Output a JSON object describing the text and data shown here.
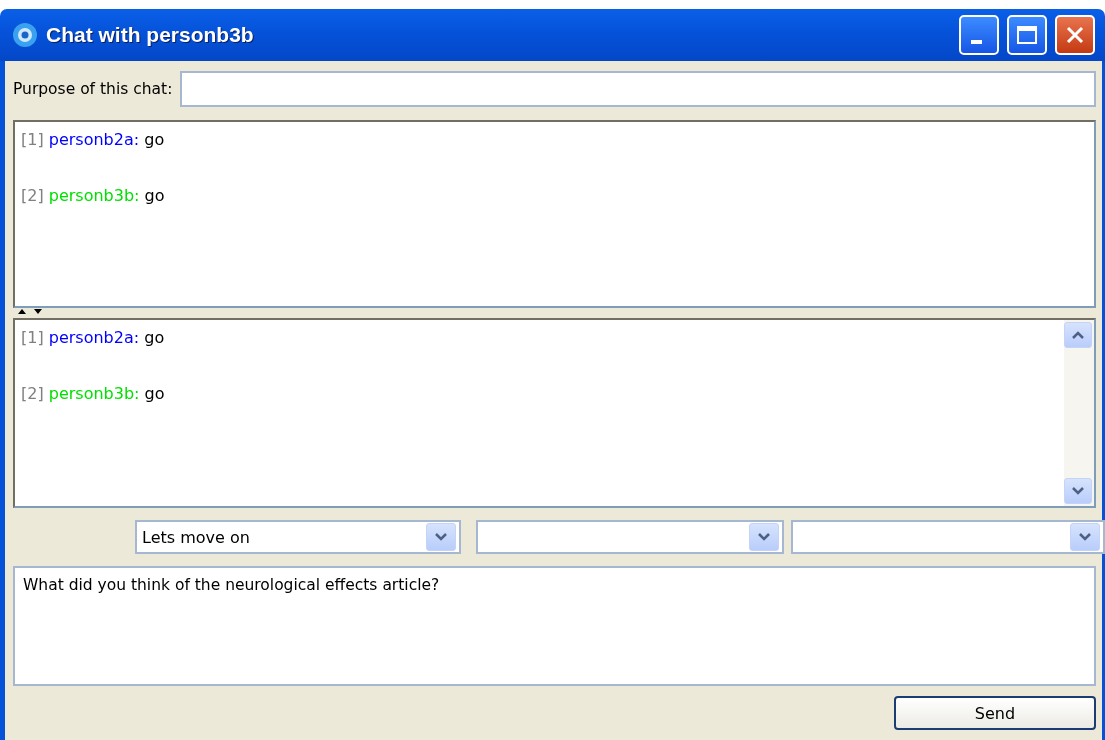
{
  "window": {
    "title": "Chat with personb3b"
  },
  "purpose": {
    "label": "Purpose of this chat:"
  },
  "transcript_top": [
    {
      "index": "[1]",
      "sender": "personb2a:",
      "color": "#0000ff",
      "text": "go"
    },
    {
      "index": "[2]",
      "sender": "personb3b:",
      "color": "#00e000",
      "text": "go"
    }
  ],
  "transcript_bottom": [
    {
      "index": "[1]",
      "sender": "personb2a:",
      "color": "#0000ff",
      "text": "go"
    },
    {
      "index": "[2]",
      "sender": "personb3b:",
      "color": "#00e000",
      "text": "go"
    }
  ],
  "dropdowns": [
    {
      "kind": "text",
      "value": "Lets move on"
    },
    {
      "kind": "blank"
    },
    {
      "kind": "blank"
    }
  ],
  "message": {
    "value": "What did you think of the neurological effects article?"
  },
  "send_button": {
    "label": "Send"
  }
}
